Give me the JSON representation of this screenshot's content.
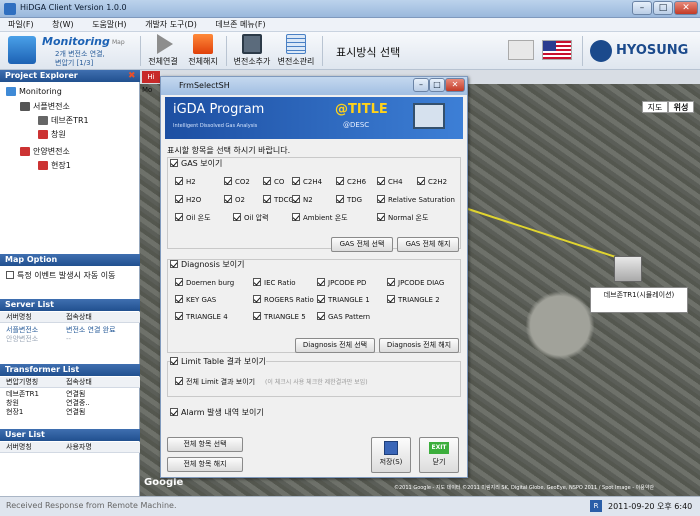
{
  "window": {
    "title": "HiDGA Client Version 1.0.0"
  },
  "menu": [
    "파일(F)",
    "창(W)",
    "도움말(H)",
    "개발자 도구(D)",
    "데브존 메뉴(F)"
  ],
  "toolbar": {
    "monitoring_title": "Monitoring",
    "monitoring_sub": "Map",
    "status_line1": "2개 변전소 연결,",
    "status_line2": "변압기 [1/3]",
    "buttons": [
      "전체연결",
      "전체해지",
      "변전소추가",
      "변전소관리"
    ],
    "display_mode": "표시방식 선택",
    "brand": "HYOSUNG"
  },
  "project_explorer": {
    "header": "Project Explorer",
    "tree": [
      {
        "label": "Monitoring",
        "level": 0
      },
      {
        "label": "서플변전소",
        "level": 1
      },
      {
        "label": "데브존TR1",
        "level": 2
      },
      {
        "label": "창원",
        "level": 2
      },
      {
        "label": "안양변전소",
        "level": 1
      },
      {
        "label": "현장1",
        "level": 2
      }
    ]
  },
  "map_option": {
    "header": "Map Option",
    "checkbox_label": "특정 이벤트 발생시 자동 이동"
  },
  "server_list": {
    "header": "Server List",
    "columns": [
      "서버명칭",
      "접속상태"
    ],
    "rows": [
      [
        "서플변전소",
        "변전소 연결 완료"
      ],
      [
        "안양변전소",
        "--"
      ]
    ]
  },
  "transformer_list": {
    "header": "Transformer List",
    "columns": [
      "변압기명칭",
      "접속상태"
    ],
    "rows": [
      [
        "데브존TR1",
        "연결됨"
      ],
      [
        "창원",
        "연결중.."
      ],
      [
        "현장1",
        "연결됨"
      ]
    ]
  },
  "user_list": {
    "header": "User List",
    "columns": [
      "서버명칭",
      "사용자명"
    ]
  },
  "map": {
    "tab_map": "지도",
    "tab_satellite": "위성",
    "marker_label": "데브존TR1(시뮬레이션)",
    "attribution": "©2011 Google - 지도 데이터 ©2011 미림지리 SK, Digital Globe, GeoEye, NSPO 2011 / Spot Image - 이용약관",
    "google": "Google",
    "hidden_tab": "Hi",
    "hidden_tab2": "Mo"
  },
  "status_bar": {
    "message": "Received Response from Remote Machine.",
    "indicator": "R",
    "datetime": "2011-09-20 오후 6:40"
  },
  "dialog": {
    "title": "FrmSelectSH",
    "banner_title": "iGDA Program",
    "banner_subtitle": "Intelligent Dissolved Gas Analysis",
    "banner_tag": "@TITLE",
    "banner_desc": "@DESC",
    "instruction": "표시할 항목을 선택 하시기 바랍니다.",
    "gas_group": "GAS 보이기",
    "gas_items": [
      "H2",
      "CO2",
      "CO",
      "C2H4",
      "C2H6",
      "CH4",
      "C2H2",
      "H2O",
      "O2",
      "TDCG",
      "N2",
      "TDG",
      "Relative Saturation",
      "Oil 온도",
      "Oil 압력",
      "Ambient 온도",
      "Normal 온도"
    ],
    "gas_select_all": "GAS 전체 선택",
    "gas_deselect_all": "GAS 전체 해지",
    "diag_group": "Diagnosis 보이기",
    "diag_items": [
      "Doernen burg",
      "IEC Ratio",
      "JPCODE PD",
      "JPCODE DIAG",
      "KEY GAS",
      "ROGERS Ratio",
      "TRIANGLE 1",
      "TRIANGLE 2",
      "TRIANGLE 4",
      "TRIANGLE 5",
      "GAS Pattern"
    ],
    "diag_select_all": "Diagnosis 전체 선택",
    "diag_deselect_all": "Diagnosis 전체 해지",
    "limit_group": "Limit Table 결과 보이기",
    "limit_item": "전체 Limit 결과 보이기",
    "limit_hint": "(이 체크시 사용 체크한 제한결과만 보임)",
    "alarm_item": "Alarm 발생 내역 보이기",
    "select_all": "전체 항목 선택",
    "deselect_all": "전체 항목 해지",
    "save": "저장(S)",
    "exit": "닫기",
    "exit_icon_text": "EXIT"
  }
}
